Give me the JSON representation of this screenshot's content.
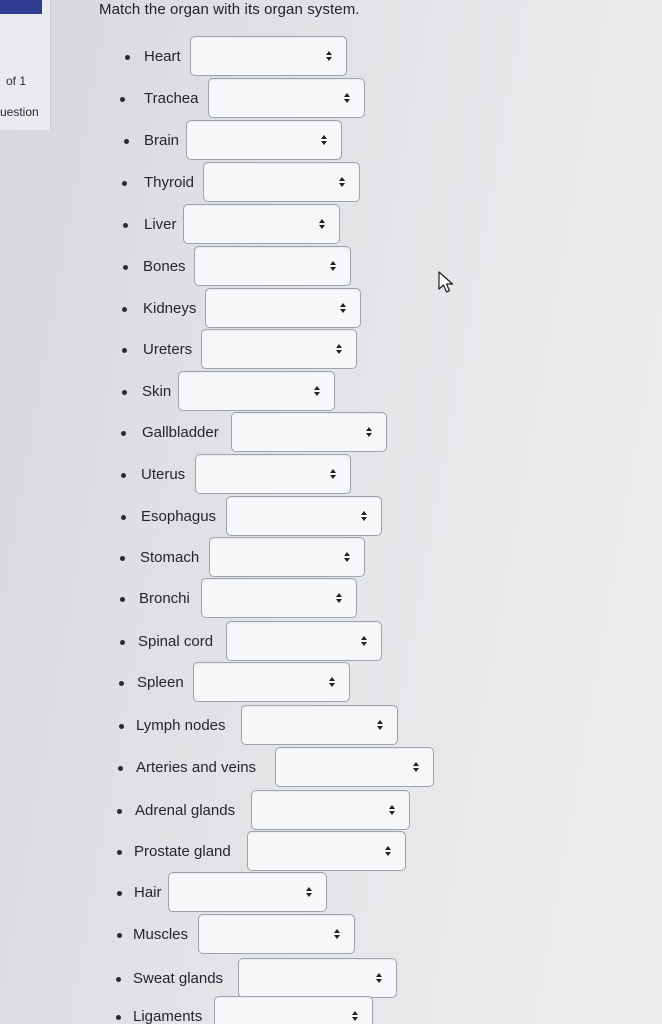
{
  "sidebar": {
    "question_count": "of 1",
    "question_label": "uestion"
  },
  "prompt": "Match the organ with its organ system.",
  "icons": {
    "select_arrow": "up-down-chevron-icon",
    "cursor": "mouse-pointer-icon"
  },
  "items": [
    {
      "organ": "Heart",
      "selected": ""
    },
    {
      "organ": "Trachea",
      "selected": ""
    },
    {
      "organ": "Brain",
      "selected": ""
    },
    {
      "organ": "Thyroid",
      "selected": ""
    },
    {
      "organ": "Liver",
      "selected": ""
    },
    {
      "organ": "Bones",
      "selected": ""
    },
    {
      "organ": "Kidneys",
      "selected": ""
    },
    {
      "organ": "Ureters",
      "selected": ""
    },
    {
      "organ": "Skin",
      "selected": ""
    },
    {
      "organ": "Gallbladder",
      "selected": ""
    },
    {
      "organ": "Uterus",
      "selected": ""
    },
    {
      "organ": "Esophagus",
      "selected": ""
    },
    {
      "organ": "Stomach",
      "selected": ""
    },
    {
      "organ": "Bronchi",
      "selected": ""
    },
    {
      "organ": "Spinal cord",
      "selected": ""
    },
    {
      "organ": "Spleen",
      "selected": ""
    },
    {
      "organ": "Lymph nodes",
      "selected": ""
    },
    {
      "organ": "Arteries and veins",
      "selected": ""
    },
    {
      "organ": "Adrenal glands",
      "selected": ""
    },
    {
      "organ": "Prostate gland",
      "selected": ""
    },
    {
      "organ": "Hair",
      "selected": ""
    },
    {
      "organ": "Muscles",
      "selected": ""
    },
    {
      "organ": "Sweat glands",
      "selected": ""
    },
    {
      "organ": "Ligaments",
      "selected": ""
    }
  ]
}
